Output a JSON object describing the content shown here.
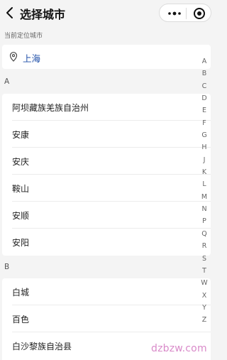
{
  "header": {
    "title": "选择城市"
  },
  "current_location": {
    "section_label": "当前定位城市",
    "city": "上海"
  },
  "groups": [
    {
      "letter": "A",
      "cities": [
        "阿坝藏族羌族自治州",
        "安康",
        "安庆",
        "鞍山",
        "安顺",
        "安阳"
      ]
    },
    {
      "letter": "B",
      "cities": [
        "白城",
        "百色",
        "白沙黎族自治县"
      ]
    }
  ],
  "index_letters": [
    "A",
    "B",
    "C",
    "D",
    "E",
    "F",
    "G",
    "H",
    "J",
    "K",
    "L",
    "M",
    "N",
    "P",
    "Q",
    "R",
    "S",
    "T",
    "W",
    "X",
    "Y",
    "Z"
  ],
  "watermark": "dzbzw.com",
  "colors": {
    "accent": "#1e4ea8",
    "background": "#f4f4f4",
    "watermark": "#d98ac9"
  },
  "icons": {
    "back": "chevron-left-icon",
    "more": "more-dots-icon",
    "close": "target-icon",
    "location": "location-pin-icon"
  }
}
